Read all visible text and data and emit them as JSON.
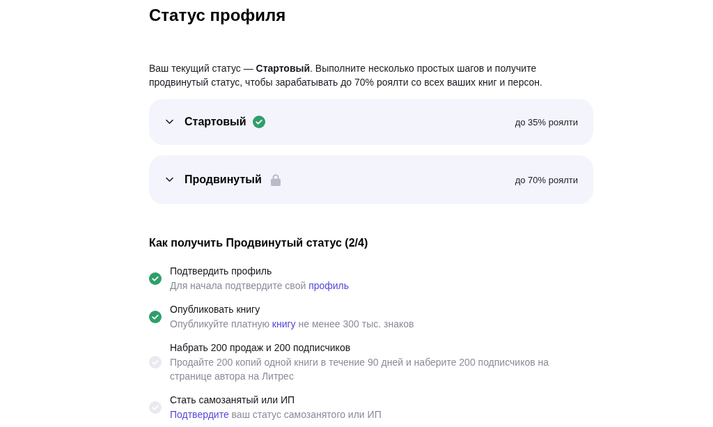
{
  "page": {
    "title": "Статус профиля",
    "intro": "Ваш текущий статус — **Стартовый**. Выполните несколько простых шагов и получите продвинутый статус, чтобы зарабатывать до 70% роялти со всех ваших книг и персон."
  },
  "levels": [
    {
      "name": "Стартовый",
      "royalty": "до 35% роялти",
      "achieved": true,
      "expanded": false
    },
    {
      "name": "Продвинутый",
      "royalty": "до 70% роялти",
      "achieved": false,
      "expanded": false
    }
  ],
  "requirements": {
    "heading": "Как получить Продвинутый статус (2/4)",
    "steps": [
      {
        "title": "Подтвердить профиль",
        "done": true,
        "description": [
          {
            "kind": "text",
            "text": "Для начала подтвердите свой "
          },
          {
            "kind": "link",
            "text": "профиль"
          }
        ]
      },
      {
        "title": "Опубликовать книгу",
        "done": true,
        "description": [
          {
            "kind": "text",
            "text": "Опубликуйте платную "
          },
          {
            "kind": "link",
            "text": "книгу"
          },
          {
            "kind": "text",
            "text": " не менее 300 тыс. знаков"
          }
        ]
      },
      {
        "title": "Набрать 200 продаж и 200 подписчиков",
        "done": false,
        "description": [
          {
            "kind": "text",
            "text": "Продайте 200 копий одной книги в течение 90 дней и наберите 200 подписчиков на странице автора на Литрес"
          }
        ]
      },
      {
        "title": "Стать самозанятый или ИП",
        "done": false,
        "description": [
          {
            "kind": "link",
            "text": "Подтвердите"
          },
          {
            "kind": "text",
            "text": " ваш статус самозанятого или ИП"
          }
        ]
      }
    ]
  }
}
